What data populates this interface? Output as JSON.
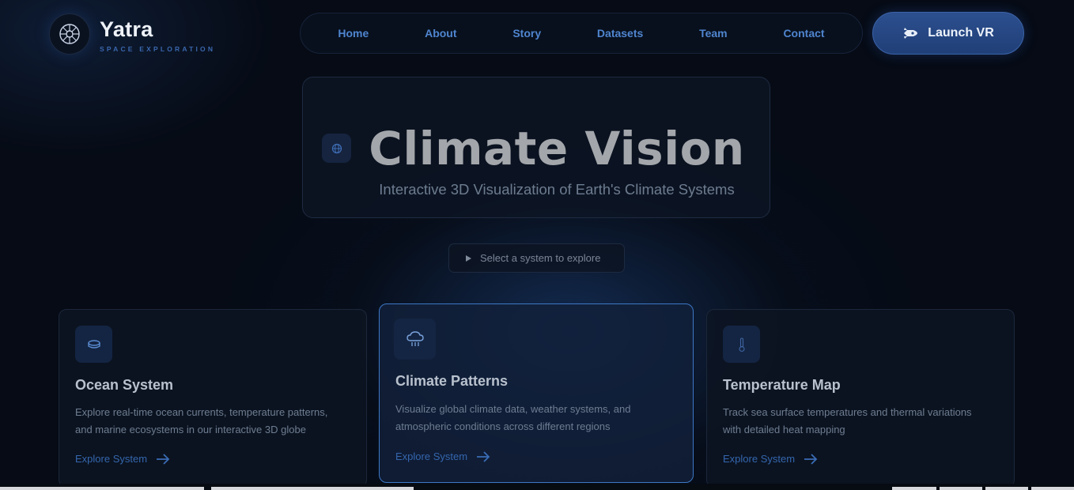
{
  "brand": {
    "title": "Yatra",
    "subtitle": "SPACE EXPLORATION"
  },
  "nav": [
    "Home",
    "About",
    "Story",
    "Datasets",
    "Team",
    "Contact"
  ],
  "launch_button": "Launch VR",
  "hero": {
    "title": "Climate Vision",
    "subtitle": "Interactive 3D Visualization of Earth's Climate Systems"
  },
  "select_prompt": "Select a system to explore",
  "cards": [
    {
      "title": "Ocean System",
      "desc_1": "Explore real-time ocean currents, temperature patterns,",
      "desc_2": "and marine ecosystems in our interactive 3D globe",
      "link": "Explore System",
      "icon": "ocean-icon"
    },
    {
      "title": "Climate Patterns",
      "desc_1": "Visualize global climate data, weather systems, and",
      "desc_2": "atmospheric conditions across different regions",
      "link": "Explore System",
      "icon": "cloud-rain-icon"
    },
    {
      "title": "Temperature Map",
      "desc_1": "Track sea surface temperatures and thermal variations",
      "desc_2": "with detailed heat mapping",
      "link": "Explore System",
      "icon": "thermometer-icon"
    }
  ],
  "colors": {
    "accent": "#3d78c6",
    "link": "#4f85cf",
    "background": "#060b15"
  }
}
